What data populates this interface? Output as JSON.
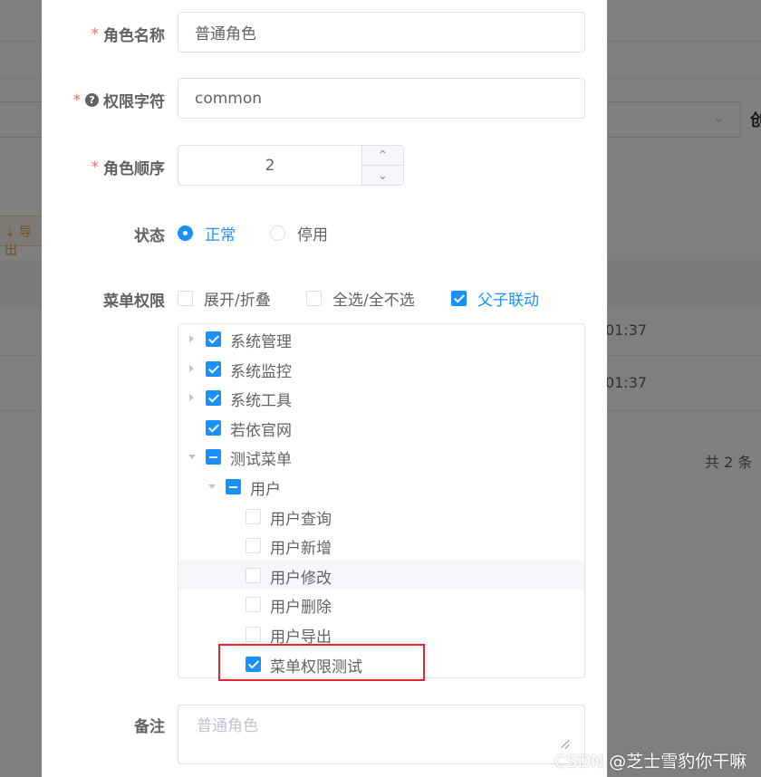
{
  "background": {
    "export_label": "⇣ 导出",
    "row_times": [
      "01:37",
      "01:37"
    ],
    "total_text": "共 2 条",
    "cut_label": "创"
  },
  "form": {
    "role_name": {
      "label": "角色名称",
      "required": "*",
      "value": "普通角色"
    },
    "role_key": {
      "label": "权限字符",
      "required": "*",
      "help_icon": "?",
      "value": "common"
    },
    "role_order": {
      "label": "角色顺序",
      "required": "*",
      "value": "2",
      "up": "⌃",
      "down": "⌄"
    },
    "status": {
      "label": "状态",
      "options": [
        {
          "label": "正常",
          "selected": true
        },
        {
          "label": "停用",
          "selected": false
        }
      ]
    },
    "menu_perm": {
      "label": "菜单权限",
      "options": [
        {
          "label": "展开/折叠",
          "checked": false
        },
        {
          "label": "全选/全不选",
          "checked": false
        },
        {
          "label": "父子联动",
          "checked": true
        }
      ],
      "tree": [
        {
          "label": "系统管理",
          "level": 0,
          "expander": "collapsed",
          "state": "checked"
        },
        {
          "label": "系统监控",
          "level": 0,
          "expander": "collapsed",
          "state": "checked"
        },
        {
          "label": "系统工具",
          "level": 0,
          "expander": "collapsed",
          "state": "checked"
        },
        {
          "label": "若依官网",
          "level": 0,
          "expander": "none",
          "state": "checked"
        },
        {
          "label": "测试菜单",
          "level": 0,
          "expander": "expanded",
          "state": "indeterminate"
        },
        {
          "label": "用户",
          "level": 1,
          "expander": "expanded",
          "state": "indeterminate"
        },
        {
          "label": "用户查询",
          "level": 2,
          "expander": "none",
          "state": "unchecked"
        },
        {
          "label": "用户新增",
          "level": 2,
          "expander": "none",
          "state": "unchecked"
        },
        {
          "label": "用户修改",
          "level": 2,
          "expander": "none",
          "state": "unchecked"
        },
        {
          "label": "用户删除",
          "level": 2,
          "expander": "none",
          "state": "unchecked"
        },
        {
          "label": "用户导出",
          "level": 2,
          "expander": "none",
          "state": "unchecked"
        },
        {
          "label": "菜单权限测试",
          "level": 2,
          "expander": "none",
          "state": "checked"
        }
      ]
    },
    "remark": {
      "label": "备注",
      "placeholder": "普通角色"
    }
  },
  "colors": {
    "primary": "#1890ff",
    "required": "#f56c6c",
    "highlight": "#e0262e"
  },
  "watermark": "CSDN @芝士雪豹你干嘛"
}
